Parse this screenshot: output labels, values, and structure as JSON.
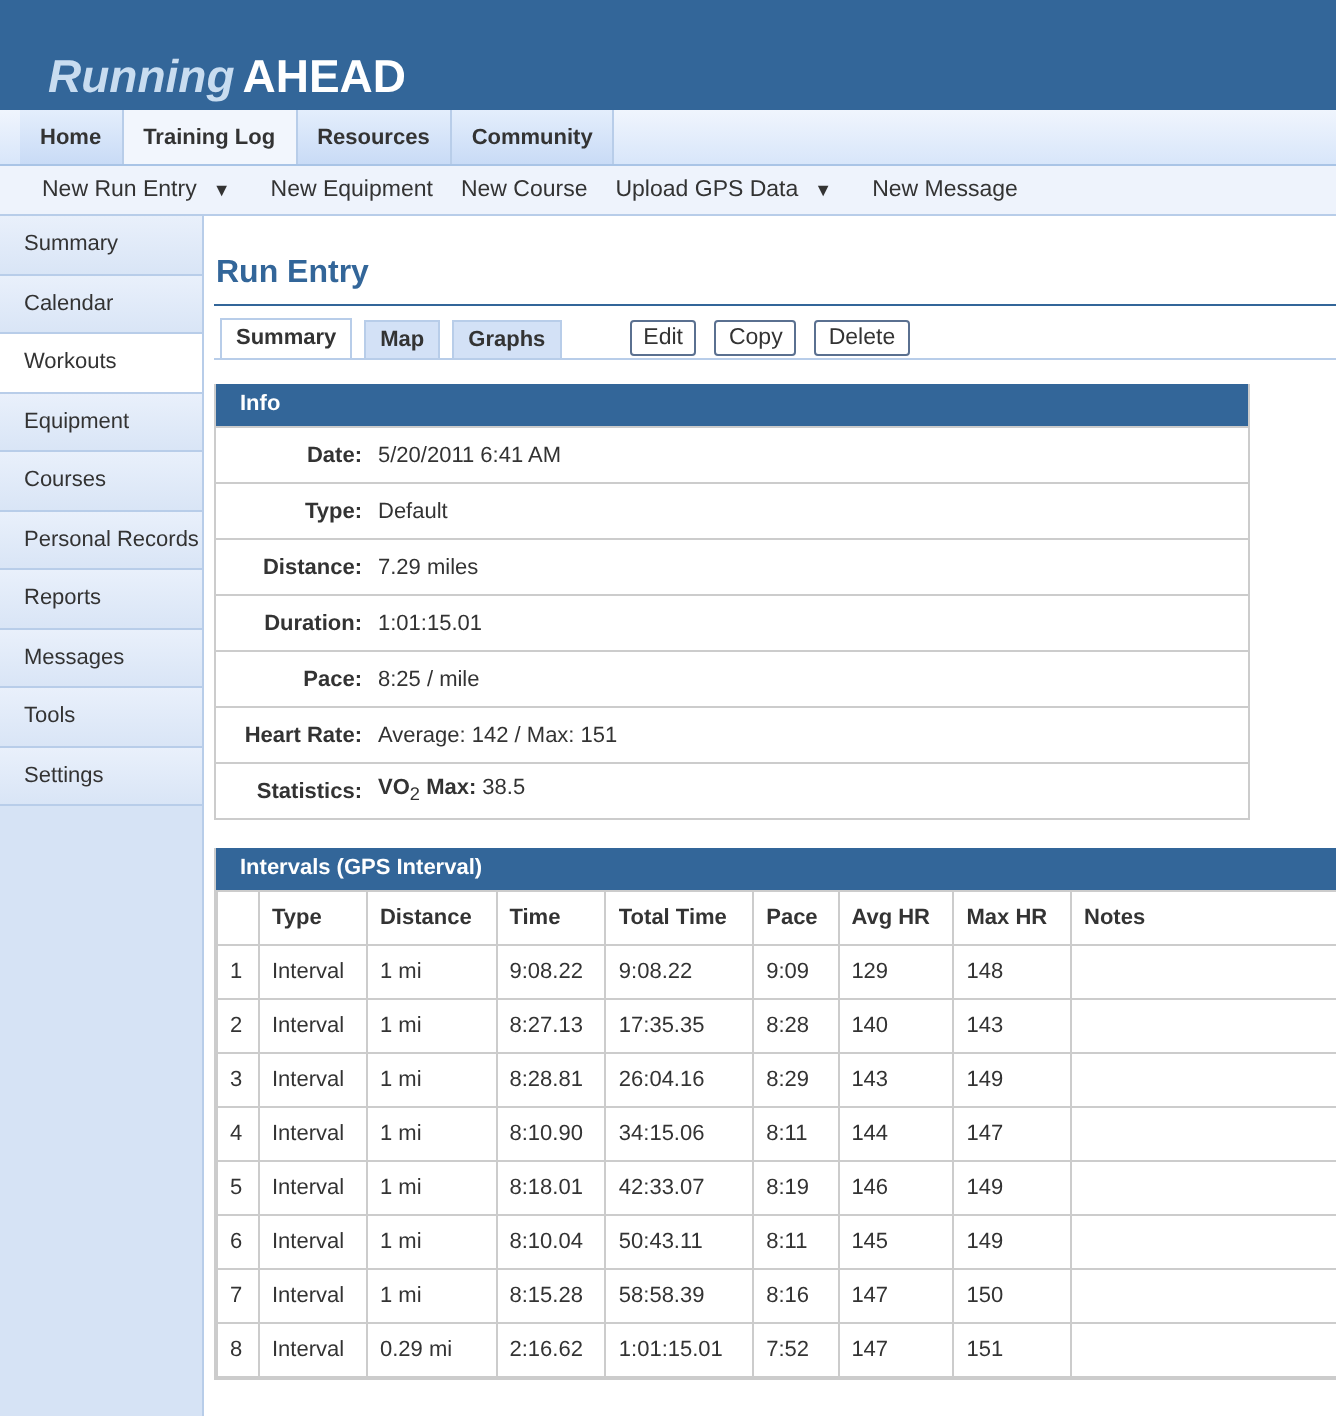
{
  "logo": {
    "first": "Running",
    "second": "AHEAD"
  },
  "nav_tabs": [
    {
      "label": "Home",
      "selected": false
    },
    {
      "label": "Training Log",
      "selected": true
    },
    {
      "label": "Resources",
      "selected": false
    },
    {
      "label": "Community",
      "selected": false
    }
  ],
  "sub_nav": [
    {
      "label": "New Run Entry",
      "caret": "▼"
    },
    {
      "label": "New Equipment"
    },
    {
      "label": "New Course"
    },
    {
      "label": "Upload GPS Data",
      "caret": "▼"
    },
    {
      "label": "New Message"
    }
  ],
  "sidebar": {
    "items": [
      {
        "label": "Summary",
        "selected": false
      },
      {
        "label": "Calendar",
        "selected": false
      },
      {
        "label": "Workouts",
        "selected": true
      },
      {
        "label": "Equipment",
        "selected": false
      },
      {
        "label": "Courses",
        "selected": false
      },
      {
        "label": "Personal Records",
        "selected": false
      },
      {
        "label": "Reports",
        "selected": false
      },
      {
        "label": "Messages",
        "selected": false
      },
      {
        "label": "Tools",
        "selected": false
      },
      {
        "label": "Settings",
        "selected": false
      }
    ]
  },
  "page_title": "Run Entry",
  "view_tabs": [
    {
      "label": "Summary",
      "selected": true
    },
    {
      "label": "Map",
      "selected": false
    },
    {
      "label": "Graphs",
      "selected": false
    }
  ],
  "actions": [
    "Edit",
    "Copy",
    "Delete"
  ],
  "info": {
    "title": "Info",
    "rows": [
      {
        "label": "Date:",
        "value": "5/20/2011 6:41 AM"
      },
      {
        "label": "Type:",
        "value": "Default"
      },
      {
        "label": "Distance:",
        "value": "7.29 miles"
      },
      {
        "label": "Duration:",
        "value": "1:01:15.01"
      },
      {
        "label": "Pace:",
        "value": "8:25 / mile"
      },
      {
        "label": "Heart Rate:",
        "value": "Average: 142 / Max: 151"
      },
      {
        "label": "Statistics:",
        "value": "**VO**$_{2}$ **Max:** 38.5"
      }
    ]
  },
  "intervals": {
    "title": "Intervals (GPS Interval)",
    "columns": [
      "",
      "Type",
      "Distance",
      "Time",
      "Total Time",
      "Pace",
      "Avg HR",
      "Max HR",
      "Notes"
    ],
    "rows": [
      [
        "1",
        "Interval",
        "1 mi",
        "9:08.22",
        "9:08.22",
        "9:09",
        "129",
        "148"
      ],
      [
        "2",
        "Interval",
        "1 mi",
        "8:27.13",
        "17:35.35",
        "8:28",
        "140",
        "143"
      ],
      [
        "3",
        "Interval",
        "1 mi",
        "8:28.81",
        "26:04.16",
        "8:29",
        "143",
        "149"
      ],
      [
        "4",
        "Interval",
        "1 mi",
        "8:10.90",
        "34:15.06",
        "8:11",
        "144",
        "147"
      ],
      [
        "5",
        "Interval",
        "1 mi",
        "8:18.01",
        "42:33.07",
        "8:19",
        "146",
        "149"
      ],
      [
        "6",
        "Interval",
        "1 mi",
        "8:10.04",
        "50:43.11",
        "8:11",
        "145",
        "149"
      ],
      [
        "7",
        "Interval",
        "1 mi",
        "8:15.28",
        "58:58.39",
        "8:16",
        "147",
        "150"
      ],
      [
        "8",
        "Interval",
        "0.29 mi",
        "2:16.62",
        "1:01:15.01",
        "7:52",
        "147",
        "151"
      ]
    ]
  }
}
